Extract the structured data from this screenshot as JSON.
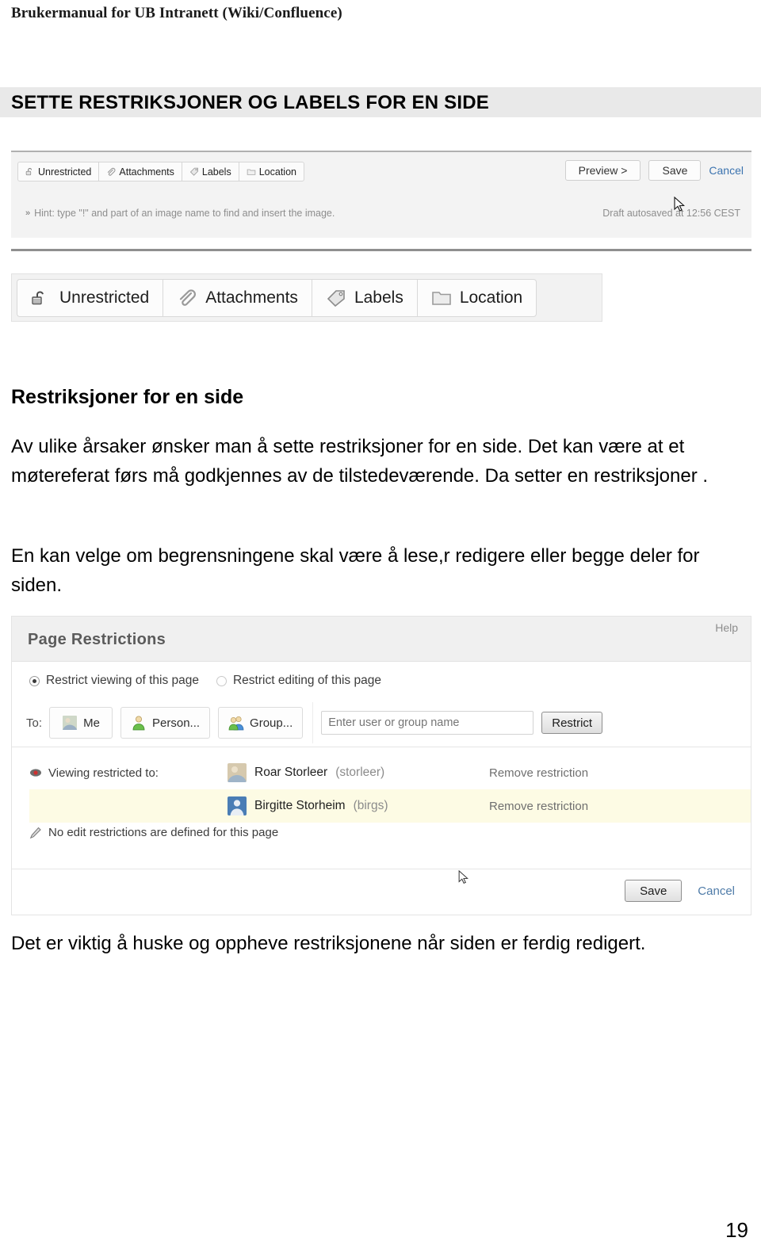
{
  "document": {
    "running_header": "Brukermanual for UB Intranett (Wiki/Confluence)",
    "section_title": "SETTE RESTRIKSJONER OG LABELS FOR EN SIDE",
    "page_number": "19"
  },
  "body": {
    "heading": "Restriksjoner for en side",
    "paragraph1": "Av ulike årsaker ønsker man å sette restriksjoner for en side. Det kan være at et møtereferat førs må godkjennes av de tilstedeværende. Da setter en restriksjoner .",
    "paragraph2": "En kan velge om begrensningene skal være å lese,r redigere eller begge deler for siden.",
    "paragraph3": "Det er viktig å huske og oppheve restriksjonene når siden er ferdig redigert."
  },
  "editor_toolbar": {
    "buttons": [
      {
        "label": "Unrestricted",
        "icon": "open-padlock-icon"
      },
      {
        "label": "Attachments",
        "icon": "paperclip-icon"
      },
      {
        "label": "Labels",
        "icon": "tag-icon"
      },
      {
        "label": "Location",
        "icon": "folder-icon"
      }
    ],
    "preview_label": "Preview >",
    "save_label": "Save",
    "cancel_label": "Cancel",
    "hint_arrows": "»",
    "hint_text": "Hint: type \"!\" and part of an image name to find and insert the image.",
    "autosave_text": "Draft autosaved at 12:56 CEST"
  },
  "big_buttons": [
    {
      "label": "Unrestricted",
      "icon": "open-padlock-icon"
    },
    {
      "label": "Attachments",
      "icon": "paperclip-icon"
    },
    {
      "label": "Labels",
      "icon": "tag-icon"
    },
    {
      "label": "Location",
      "icon": "folder-icon"
    }
  ],
  "restrictions_dialog": {
    "title": "Page Restrictions",
    "help_label": "Help",
    "radio_view_label": "Restrict viewing of this page",
    "radio_edit_label": "Restrict editing of this page",
    "radio_selected": "view",
    "to_label": "To:",
    "pick_me_label": "Me",
    "pick_person_label": "Person...",
    "pick_group_label": "Group...",
    "name_input_placeholder": "Enter user or group name",
    "name_input_value": "",
    "restrict_button_label": "Restrict",
    "viewing_restricted_label": "Viewing restricted to:",
    "rows": [
      {
        "name": "Roar Storleer",
        "userid": "(storleer)",
        "remove_label": "Remove restriction"
      },
      {
        "name": "Birgitte Storheim",
        "userid": "(birgs)",
        "remove_label": "Remove restriction"
      }
    ],
    "no_edit_restrictions_text": "No edit restrictions are defined for this page",
    "save_label": "Save",
    "cancel_label": "Cancel",
    "highlight_color": "#fdfbe4"
  }
}
